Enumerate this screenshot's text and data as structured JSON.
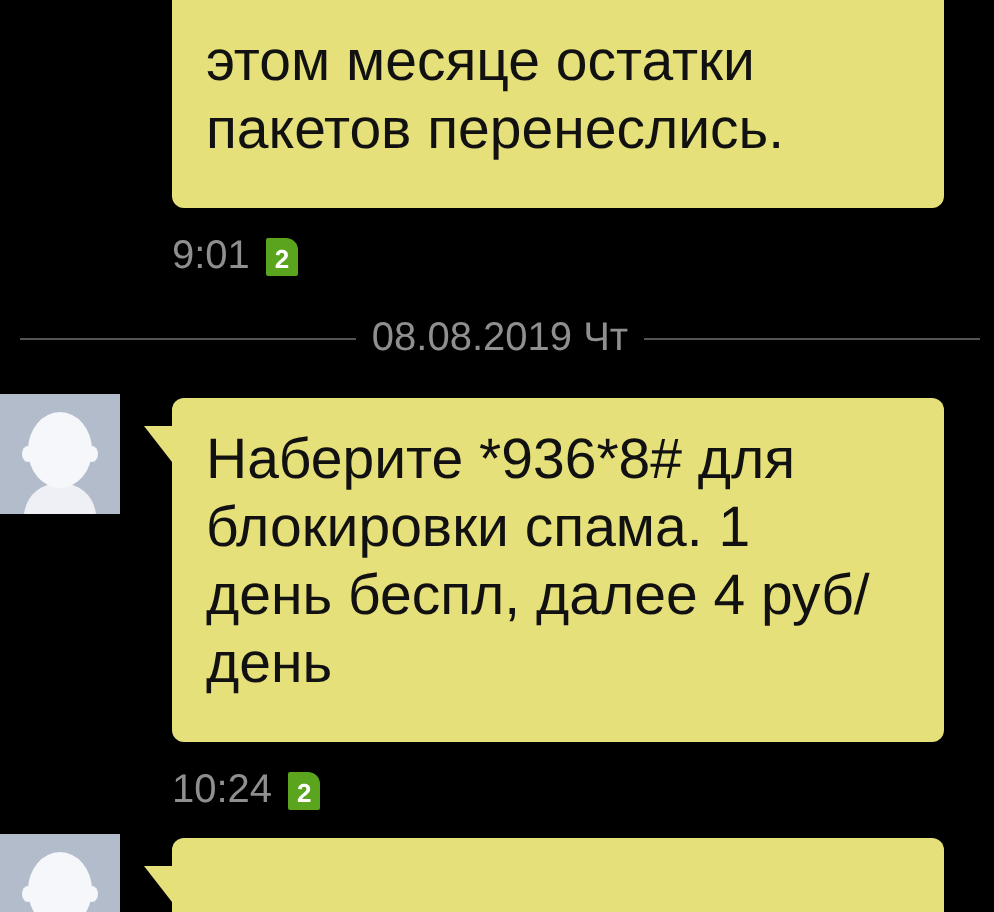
{
  "messages": [
    {
      "avatar": false,
      "text": "этом месяце остатки\nпакетов перенеслись.",
      "time": "9:01",
      "sim": "2"
    },
    {
      "kind": "separator",
      "date": "08.08.2019 Чт"
    },
    {
      "avatar": true,
      "text": "Наберите *936*8# для\nблокировки спама. 1\nдень беспл, далее 4 руб/\nдень",
      "time": "10:24",
      "sim": "2"
    },
    {
      "avatar": true
    }
  ]
}
